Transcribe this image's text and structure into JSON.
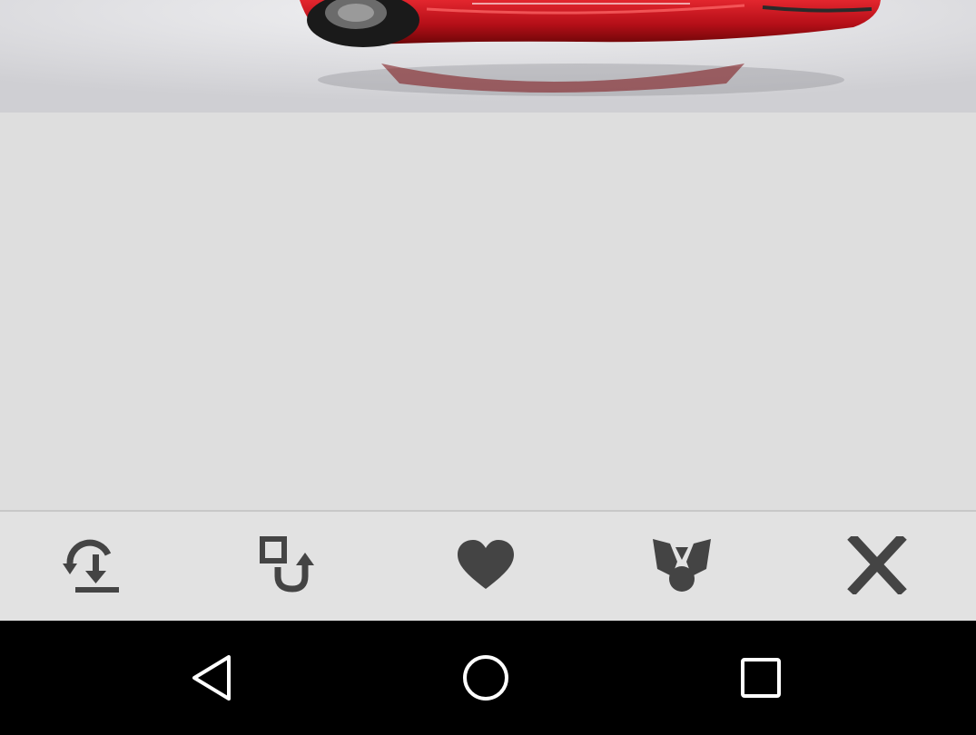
{
  "colors": {
    "icon": "#444444",
    "toolbar_bg": "#e2e2e2",
    "content_bg": "#dedede",
    "navbar_bg": "#000000",
    "nav_icon": "#ffffff",
    "car_red": "#c0141c"
  },
  "photo": {
    "subject": "red-sports-car"
  },
  "toolbar": {
    "buttons": [
      {
        "icon": "rotate-download-icon"
      },
      {
        "icon": "set-wallpaper-icon"
      },
      {
        "icon": "heart-icon"
      },
      {
        "icon": "share-icon"
      },
      {
        "icon": "close-icon"
      }
    ]
  },
  "navbar": {
    "buttons": [
      {
        "icon": "back-icon"
      },
      {
        "icon": "home-icon"
      },
      {
        "icon": "recents-icon"
      }
    ]
  }
}
